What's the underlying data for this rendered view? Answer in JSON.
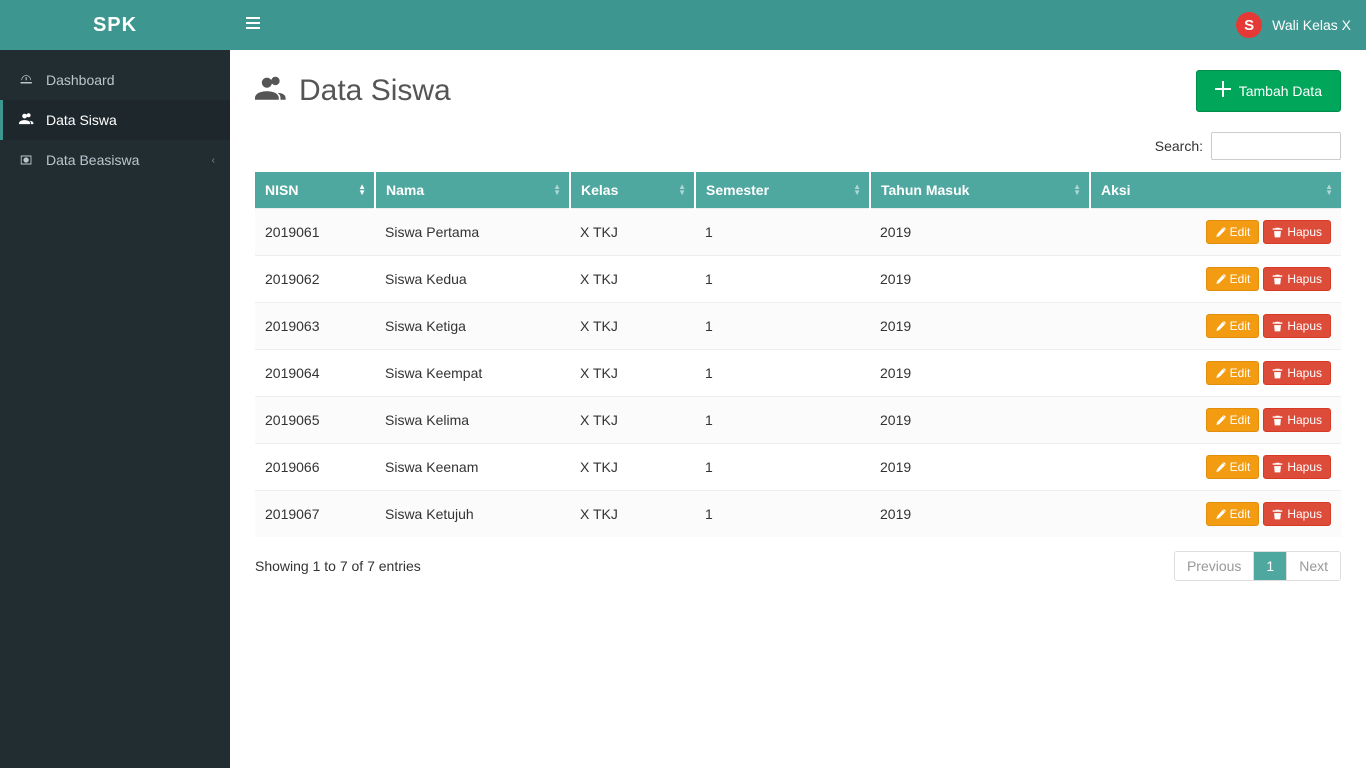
{
  "brand": "SPK",
  "user": {
    "initial": "S",
    "name": "Wali Kelas X"
  },
  "sidebar": {
    "items": [
      {
        "label": "Dashboard",
        "icon": "dashboard-icon",
        "active": false,
        "hasChildren": false
      },
      {
        "label": "Data Siswa",
        "icon": "users-icon",
        "active": true,
        "hasChildren": false
      },
      {
        "label": "Data Beasiswa",
        "icon": "money-icon",
        "active": false,
        "hasChildren": true
      }
    ]
  },
  "page": {
    "title": "Data Siswa",
    "addButton": "Tambah Data",
    "searchLabel": "Search:",
    "searchValue": "",
    "tableInfo": "Showing 1 to 7 of 7 entries",
    "prev": "Previous",
    "next": "Next",
    "pages": [
      "1"
    ]
  },
  "table": {
    "headers": [
      "NISN",
      "Nama",
      "Kelas",
      "Semester",
      "Tahun Masuk",
      "Aksi"
    ],
    "editLabel": "Edit",
    "deleteLabel": "Hapus",
    "rows": [
      {
        "nisn": "2019061",
        "nama": "Siswa Pertama",
        "kelas": "X TKJ",
        "semester": "1",
        "tahun": "2019"
      },
      {
        "nisn": "2019062",
        "nama": "Siswa Kedua",
        "kelas": "X TKJ",
        "semester": "1",
        "tahun": "2019"
      },
      {
        "nisn": "2019063",
        "nama": "Siswa Ketiga",
        "kelas": "X TKJ",
        "semester": "1",
        "tahun": "2019"
      },
      {
        "nisn": "2019064",
        "nama": "Siswa Keempat",
        "kelas": "X TKJ",
        "semester": "1",
        "tahun": "2019"
      },
      {
        "nisn": "2019065",
        "nama": "Siswa Kelima",
        "kelas": "X TKJ",
        "semester": "1",
        "tahun": "2019"
      },
      {
        "nisn": "2019066",
        "nama": "Siswa Keenam",
        "kelas": "X TKJ",
        "semester": "1",
        "tahun": "2019"
      },
      {
        "nisn": "2019067",
        "nama": "Siswa Ketujuh",
        "kelas": "X TKJ",
        "semester": "1",
        "tahun": "2019"
      }
    ]
  }
}
